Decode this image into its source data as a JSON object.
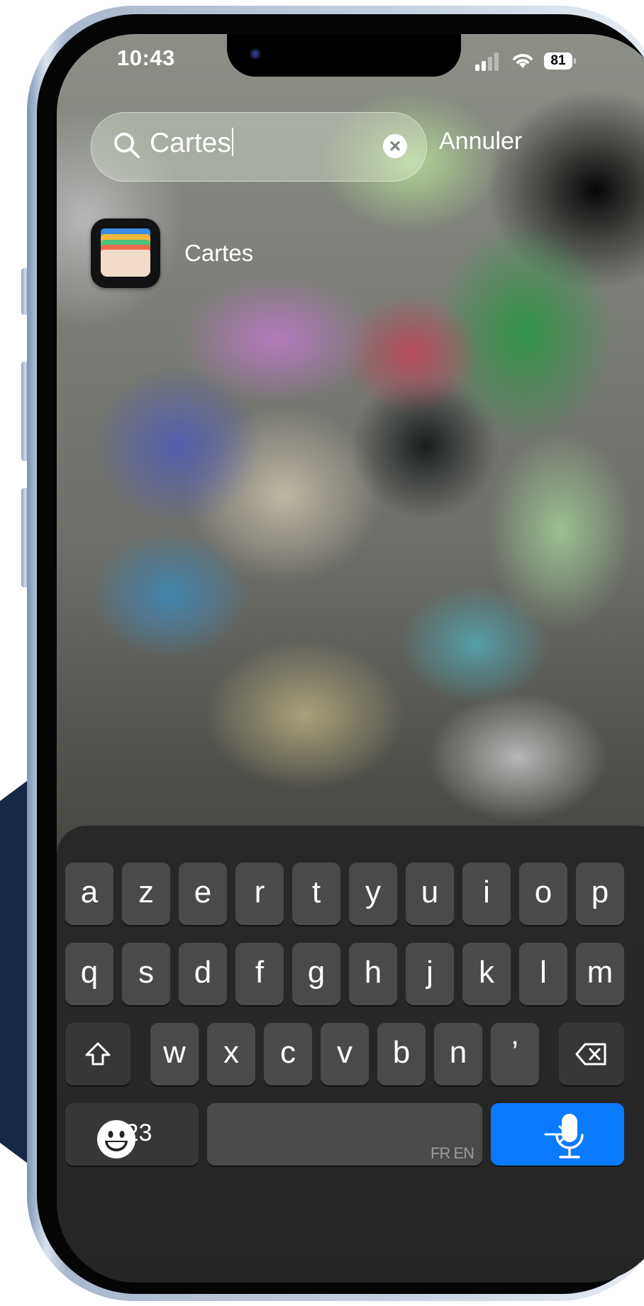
{
  "status_bar": {
    "time": "10:43",
    "battery": "81",
    "icons": [
      "signal-icon",
      "wifi-icon",
      "battery-icon"
    ]
  },
  "search": {
    "value": "Cartes",
    "clear_icon": "clear-icon",
    "search_icon": "search-icon",
    "cancel_label": "Annuler"
  },
  "results": [
    {
      "label": "Cartes",
      "icon": "wallet-app-icon"
    }
  ],
  "keyboard": {
    "row1": [
      "a",
      "z",
      "e",
      "r",
      "t",
      "y",
      "u",
      "i",
      "o",
      "p"
    ],
    "row2": [
      "q",
      "s",
      "d",
      "f",
      "g",
      "h",
      "j",
      "k",
      "l",
      "m"
    ],
    "row3": [
      "w",
      "x",
      "c",
      "v",
      "b",
      "n",
      "’"
    ],
    "numbers_label": "123",
    "languages": "FR EN",
    "shift_icon": "shift-icon",
    "delete_icon": "backspace-icon",
    "go_icon": "arrow-right-icon",
    "emoji_icon": "emoji-icon",
    "mic_icon": "microphone-icon",
    "go_color": "#0a7afe"
  }
}
